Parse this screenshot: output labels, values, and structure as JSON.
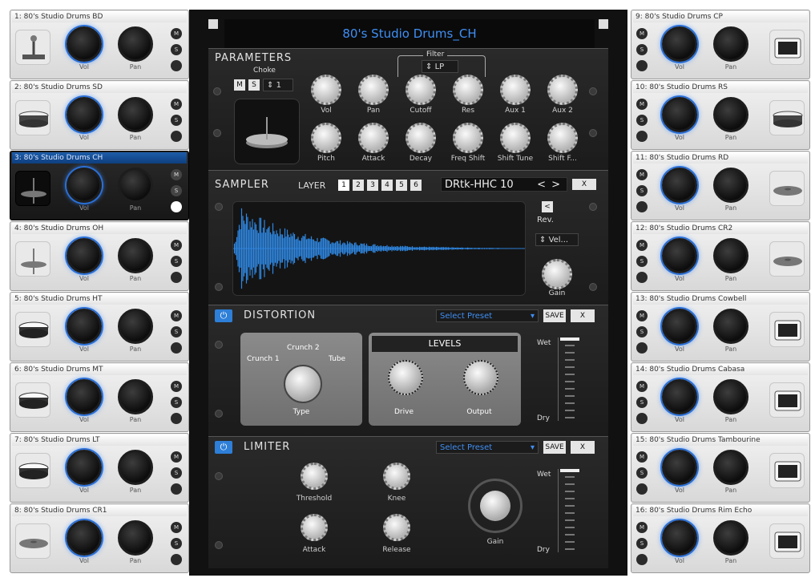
{
  "pads_left": [
    {
      "title": "1: 80's Studio Drums BD",
      "icon": "kick-pedal-icon"
    },
    {
      "title": "2: 80's Studio Drums SD",
      "icon": "snare-drum-icon"
    },
    {
      "title": "3: 80's Studio Drums CH",
      "icon": "hihat-icon",
      "selected": true
    },
    {
      "title": "4: 80's Studio Drums OH",
      "icon": "hihat-icon"
    },
    {
      "title": "5: 80's Studio Drums HT",
      "icon": "tom-drum-icon"
    },
    {
      "title": "6: 80's Studio Drums MT",
      "icon": "tom-drum-icon"
    },
    {
      "title": "7: 80's Studio Drums LT",
      "icon": "tom-drum-icon"
    },
    {
      "title": "8: 80's Studio Drums CR1",
      "icon": "cymbal-icon"
    }
  ],
  "pads_right": [
    {
      "title": "9: 80's Studio Drums CP",
      "icon": "drum-pad-icon"
    },
    {
      "title": "10: 80's Studio Drums RS",
      "icon": "snare-drum-icon"
    },
    {
      "title": "11: 80's Studio Drums RD",
      "icon": "cymbal-icon"
    },
    {
      "title": "12: 80's Studio Drums CR2",
      "icon": "cymbal-icon"
    },
    {
      "title": "13: 80's Studio Drums Cowbell",
      "icon": "drum-pad-icon"
    },
    {
      "title": "14: 80's Studio Drums Cabasa",
      "icon": "drum-pad-icon"
    },
    {
      "title": "15: 80's Studio Drums Tambourine",
      "icon": "drum-pad-icon"
    },
    {
      "title": "16: 80's Studio Drums Rim Echo",
      "icon": "drum-pad-icon"
    }
  ],
  "pad_labels": {
    "vol": "Vol",
    "pan": "Pan",
    "mute": "M",
    "solo": "S"
  },
  "instrument_title": "80's Studio Drums_CH",
  "parameters": {
    "heading": "PARAMETERS",
    "choke_label": "Choke",
    "choke_value": "1",
    "m_button": "M",
    "s_button": "S",
    "filter_label": "Filter",
    "filter_value": "LP",
    "knobs_row1": [
      "Vol",
      "Pan",
      "Cutoff",
      "Res",
      "Aux 1",
      "Aux 2"
    ],
    "knobs_row2": [
      "Pitch",
      "Attack",
      "Decay",
      "Freq Shift",
      "Shift Tune",
      "Shift F..."
    ]
  },
  "sampler": {
    "heading": "SAMPLER",
    "layer_label": "LAYER",
    "layers": [
      "1",
      "2",
      "3",
      "4",
      "5",
      "6"
    ],
    "sample_name": "DRtk-HHC 10",
    "nav_left": "<",
    "nav_right": ">",
    "close": "X",
    "rev_label": "Rev.",
    "vel_value": "Vel...",
    "gain_label": "Gain"
  },
  "distortion": {
    "heading": "DISTORTION",
    "preset": "Select Preset",
    "save": "SAVE",
    "close": "X",
    "type_modes": [
      "Crunch 1",
      "Crunch 2",
      "Tube"
    ],
    "type_label": "Type",
    "levels_heading": "LEVELS",
    "drive_label": "Drive",
    "output_label": "Output",
    "wet": "Wet",
    "dry": "Dry"
  },
  "limiter": {
    "heading": "LIMITER",
    "preset": "Select Preset",
    "save": "SAVE",
    "close": "X",
    "threshold": "Threshold",
    "knee": "Knee",
    "attack": "Attack",
    "release": "Release",
    "gain": "Gain",
    "wet": "Wet",
    "dry": "Dry"
  },
  "colors": {
    "accent": "#3f8ff5",
    "selected_pad": "#1c5ca8"
  }
}
